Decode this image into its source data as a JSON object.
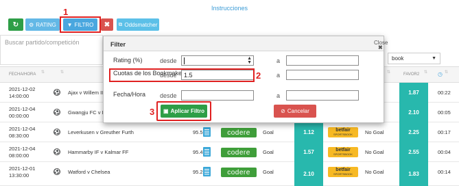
{
  "page": {
    "instructions_link": "Instrucciones"
  },
  "annotations": {
    "step1": "1",
    "step2": "2",
    "step3": "3"
  },
  "toolbar": {
    "refresh_icon": "refresh-icon",
    "rating_label": "RATING",
    "filtro_label": "FILTRO",
    "clear_label": "✖",
    "oddsmatcher_label": "Oddsmatcher"
  },
  "search": {
    "placeholder": "Buscar partido/competición"
  },
  "bookmaker_select": {
    "value": "book"
  },
  "table": {
    "headers": [
      "FECHA/HORA",
      "",
      "",
      "FAVOR2",
      ""
    ],
    "rows": [
      {
        "date": "2021-12-02",
        "time": "14:00:00",
        "match": "Ajax v Willem II",
        "rating": "",
        "bet": "",
        "odd1": "",
        "lay": "",
        "odd2": "1.87",
        "remaining": "00:22"
      },
      {
        "date": "2021-12-04",
        "time": "00:00:00",
        "match": "Gwangju FC v In",
        "rating": "",
        "bet": "",
        "odd1": "",
        "lay": "",
        "odd2": "2.10",
        "remaining": "00:05"
      },
      {
        "date": "2021-12-04",
        "time": "08:30:00",
        "match": "Leverkusen v Greuther Furth",
        "rating": "95.50",
        "bet": "Goal",
        "odd1": "1.12",
        "lay": "No Goal",
        "odd2": "2.25",
        "remaining": "00:17"
      },
      {
        "date": "2021-12-04",
        "time": "08:00:00",
        "match": "Hammarby IF v Kalmar FF",
        "rating": "95.43",
        "bet": "Goal",
        "odd1": "1.57",
        "lay": "No Goal",
        "odd2": "2.55",
        "remaining": "00:04"
      },
      {
        "date": "2021-12-01",
        "time": "13:30:00",
        "match": "Watford v Chelsea",
        "rating": "95.25",
        "bet": "Goal",
        "odd1": "2.10",
        "lay": "No Goal",
        "odd2": "1.83",
        "remaining": "00:14"
      }
    ],
    "codere_label": "codere",
    "betfair_label": "betfair",
    "betfair_sub": "SPORTSBOOK"
  },
  "modal": {
    "title": "Filter",
    "close_label": "Close",
    "rows": [
      {
        "label": "Rating (%)",
        "desde": "desde",
        "from_value": "",
        "a": "a",
        "to_value": ""
      },
      {
        "label": "Cuotas de los Bookmakers",
        "desde": "desde",
        "from_value": "1.5",
        "a": "a",
        "to_value": ""
      },
      {
        "label": "Fecha/Hora",
        "desde": "desde",
        "from_value": "",
        "a": "a",
        "to_value": ""
      }
    ],
    "apply_label": "Aplicar Filtro",
    "cancel_label": "Cancelar"
  },
  "colors": {
    "green": "#2e9e47",
    "blue": "#4aa7df",
    "red": "#d9534f",
    "teal": "#28b8ad",
    "highlight": "#e02020"
  }
}
